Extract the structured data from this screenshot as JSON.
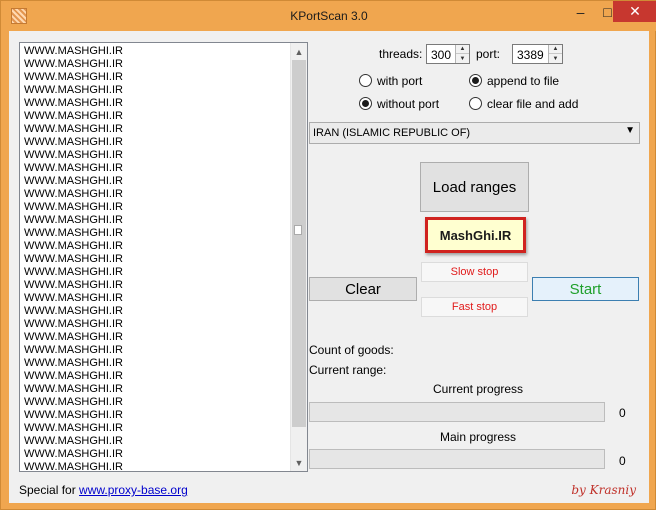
{
  "window": {
    "title": "KPortScan 3.0",
    "controls": {
      "minimize": "–",
      "maximize": "□",
      "close": "✕"
    }
  },
  "list": {
    "lines": [
      "WWW.MASHGHI.IR",
      "WWW.MASHGHI.IR",
      "WWW.MASHGHI.IR",
      "WWW.MASHGHI.IR",
      "WWW.MASHGHI.IR",
      "WWW.MASHGHI.IR",
      "WWW.MASHGHI.IR",
      "WWW.MASHGHI.IR",
      "WWW.MASHGHI.IR",
      "WWW.MASHGHI.IR",
      "WWW.MASHGHI.IR",
      "WWW.MASHGHI.IR",
      "WWW.MASHGHI.IR",
      "WWW.MASHGHI.IR",
      "WWW.MASHGHI.IR",
      "WWW.MASHGHI.IR",
      "WWW.MASHGHI.IR",
      "WWW.MASHGHI.IR",
      "WWW.MASHGHI.IR",
      "WWW.MASHGHI.IR",
      "WWW.MASHGHI.IR",
      "WWW.MASHGHI.IR",
      "WWW.MASHGHI.IR",
      "WWW.MASHGHI.IR",
      "WWW.MASHGHI.IR",
      "WWW.MASHGHI.IR",
      "WWW.MASHGHI.IR",
      "WWW.MASHGHI.IR",
      "WWW.MASHGHI.IR",
      "WWW.MASHGHI.IR",
      "WWW.MASHGHI.IR",
      "WWW.MASHGHI.IR",
      "WWW.MASHGHI.IR"
    ]
  },
  "settings": {
    "threads_label": "threads:",
    "threads_value": "300",
    "port_label": "port:",
    "port_value": "3389",
    "radio_with_port": "with port",
    "radio_without_port": "without port",
    "radio_append": "append to file",
    "radio_clear_add": "clear file and add",
    "country": "IRAN (ISLAMIC REPUBLIC OF)"
  },
  "buttons": {
    "load_ranges": "Load ranges",
    "logo_text": "MashGhi.IR",
    "slow_stop": "Slow stop",
    "fast_stop": "Fast stop",
    "clear": "Clear",
    "start": "Start"
  },
  "status": {
    "count_of_goods": "Count of goods:",
    "current_range": "Current range:",
    "current_progress_label": "Current progress",
    "current_progress_value": "0",
    "main_progress_label": "Main progress",
    "main_progress_value": "0"
  },
  "footer": {
    "special_prefix": "Special for ",
    "special_link": "www.proxy-base.org",
    "author": "by Krasniy"
  },
  "colors": {
    "title_bar": "#f0a64f",
    "close_button": "#c7372f",
    "stop_text": "#e11b1b",
    "start_text": "#1fa02b",
    "logo_border": "#d0231f",
    "author_text": "#c0312a"
  }
}
